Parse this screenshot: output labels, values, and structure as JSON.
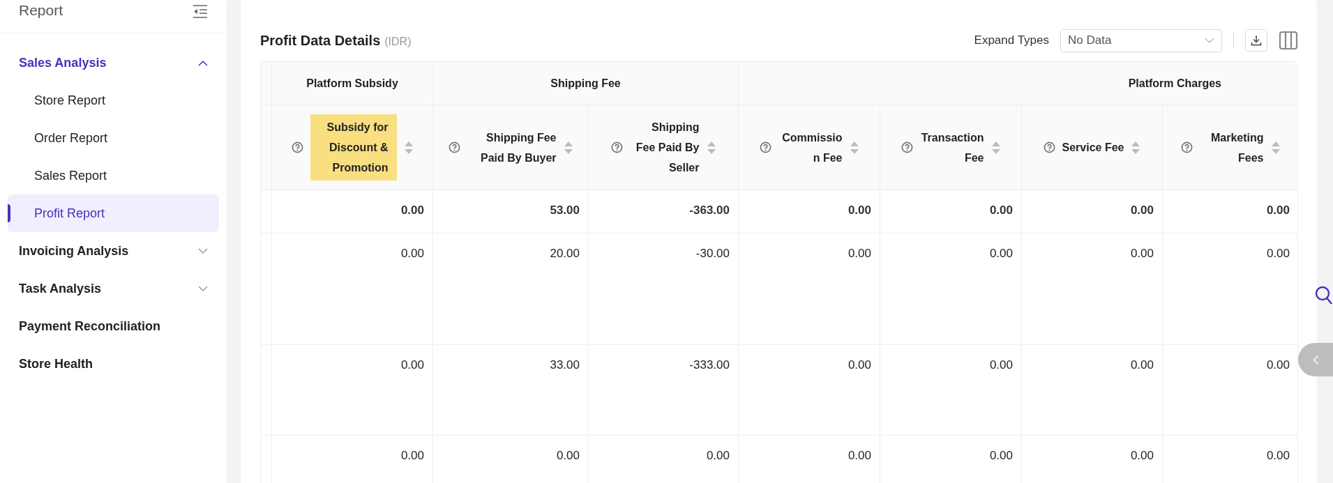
{
  "sidebar": {
    "title": "Report",
    "items": [
      {
        "label": "Sales Analysis",
        "kind": "group",
        "expanded": true,
        "active": true,
        "children": [
          {
            "label": "Store Report",
            "selected": false
          },
          {
            "label": "Order Report",
            "selected": false
          },
          {
            "label": "Sales Report",
            "selected": false
          },
          {
            "label": "Profit Report",
            "selected": true
          }
        ]
      },
      {
        "label": "Invoicing Analysis",
        "kind": "group",
        "expanded": false,
        "active": false
      },
      {
        "label": "Task Analysis",
        "kind": "group",
        "expanded": false,
        "active": false
      },
      {
        "label": "Payment Reconciliation",
        "kind": "link",
        "active": false
      },
      {
        "label": "Store Health",
        "kind": "link",
        "active": false
      }
    ]
  },
  "main": {
    "title": "Profit Data Details",
    "unit": "(IDR)",
    "expand_types": {
      "label": "Expand Types",
      "value": "No Data"
    },
    "table": {
      "groups": [
        {
          "label": "Platform Subsidy",
          "columns": [
            {
              "label": "Subsidy for Discount & Promotion",
              "highlighted": true
            }
          ]
        },
        {
          "label": "Shipping Fee",
          "columns": [
            {
              "label": "Shipping Fee Paid By Buyer",
              "highlighted": false
            },
            {
              "label": "Shipping Fee Paid By Seller",
              "highlighted": false
            }
          ]
        },
        {
          "label": "Platform Charges",
          "columns": [
            {
              "label": "Commission Fee",
              "highlighted": false
            },
            {
              "label": "Transaction Fee",
              "highlighted": false
            },
            {
              "label": "Service Fee",
              "highlighted": false
            },
            {
              "label": "Marketing Fees",
              "highlighted": false
            }
          ]
        }
      ],
      "rows": [
        {
          "kind": "summary",
          "cells": [
            "0.00",
            "53.00",
            "-363.00",
            "0.00",
            "0.00",
            "0.00",
            "0.00"
          ]
        },
        {
          "kind": "data",
          "cells": [
            "0.00",
            "20.00",
            "-30.00",
            "0.00",
            "0.00",
            "0.00",
            "0.00"
          ]
        },
        {
          "kind": "data",
          "cells": [
            "0.00",
            "33.00",
            "-333.00",
            "0.00",
            "0.00",
            "0.00",
            "0.00"
          ]
        },
        {
          "kind": "data",
          "cells": [
            "0.00",
            "0.00",
            "0.00",
            "0.00",
            "0.00",
            "0.00",
            "0.00"
          ]
        }
      ]
    }
  }
}
